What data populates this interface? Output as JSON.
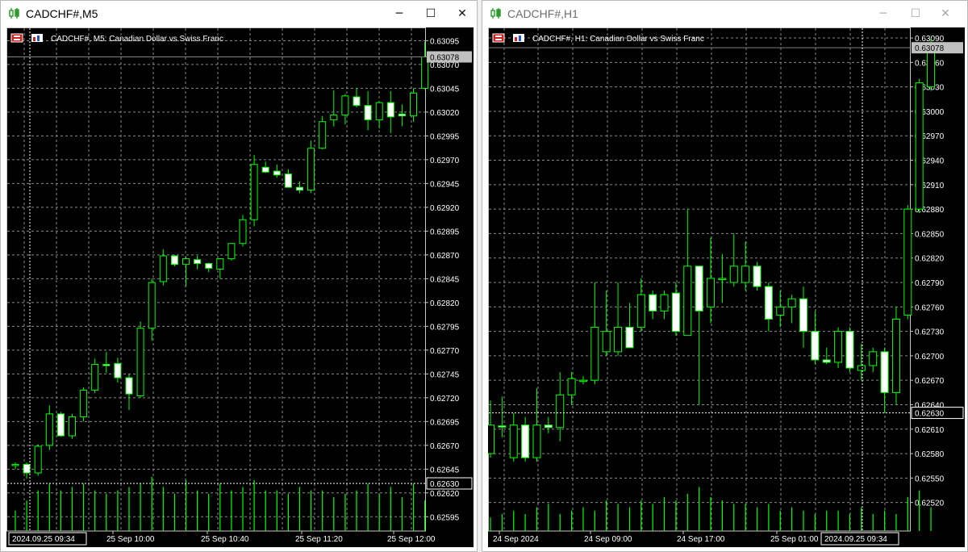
{
  "colors": {
    "background": "#000000",
    "grid": "#8a8a8a",
    "bull": "#00ff00",
    "bear": "#ffffff",
    "text": "#ffffff",
    "current_price_bg": "#c0c0c0"
  },
  "windows": [
    {
      "title": "CADCHF#,M5",
      "state": "active",
      "controls": {
        "minimize": "─",
        "maximize": "☐",
        "close": "✕"
      },
      "chart_data": {
        "type": "candlestick",
        "symbol_label": "CADCHF#, M5:  Canadian Dollar vs Swiss Franc",
        "timeframe": "M5",
        "current_price": "0.63078",
        "marked_price": "0.62630",
        "marked_value": 0.6263,
        "crosshair_time": "2024.09.25 09:34",
        "grid": true,
        "ylim": [
          0.6258,
          0.63103
        ],
        "yticks": [
          "0.63095",
          "0.63070",
          "0.63045",
          "0.63020",
          "0.62995",
          "0.62970",
          "0.62945",
          "0.62920",
          "0.62895",
          "0.62870",
          "0.62845",
          "0.62820",
          "0.62795",
          "0.62770",
          "0.62745",
          "0.62720",
          "0.62695",
          "0.62670",
          "0.62645",
          "0.62620",
          "0.62595"
        ],
        "xticks": [
          "25 Sep 10:00",
          "25 Sep 10:40",
          "25 Sep 11:20",
          "25 Sep 12:00"
        ],
        "candles": [
          {
            "o": 0.62649,
            "h": 0.62652,
            "l": 0.62645,
            "c": 0.6265
          },
          {
            "o": 0.6265,
            "h": 0.62652,
            "l": 0.62635,
            "c": 0.62641
          },
          {
            "o": 0.62641,
            "h": 0.62671,
            "l": 0.62638,
            "c": 0.62669
          },
          {
            "o": 0.6267,
            "h": 0.62712,
            "l": 0.62665,
            "c": 0.62703
          },
          {
            "o": 0.62703,
            "h": 0.62705,
            "l": 0.62679,
            "c": 0.6268
          },
          {
            "o": 0.6268,
            "h": 0.62703,
            "l": 0.62677,
            "c": 0.627
          },
          {
            "o": 0.627,
            "h": 0.62731,
            "l": 0.62695,
            "c": 0.62728
          },
          {
            "o": 0.62728,
            "h": 0.62761,
            "l": 0.62725,
            "c": 0.62755
          },
          {
            "o": 0.62755,
            "h": 0.62768,
            "l": 0.62746,
            "c": 0.62754
          },
          {
            "o": 0.62756,
            "h": 0.62762,
            "l": 0.62736,
            "c": 0.62741
          },
          {
            "o": 0.62741,
            "h": 0.62745,
            "l": 0.62707,
            "c": 0.62724
          },
          {
            "o": 0.62722,
            "h": 0.628,
            "l": 0.6272,
            "c": 0.62793
          },
          {
            "o": 0.62793,
            "h": 0.62845,
            "l": 0.6278,
            "c": 0.62841
          },
          {
            "o": 0.62842,
            "h": 0.62876,
            "l": 0.62838,
            "c": 0.62869
          },
          {
            "o": 0.62869,
            "h": 0.6287,
            "l": 0.62858,
            "c": 0.6286
          },
          {
            "o": 0.6286,
            "h": 0.62868,
            "l": 0.62837,
            "c": 0.62866
          },
          {
            "o": 0.62865,
            "h": 0.62869,
            "l": 0.62855,
            "c": 0.62861
          },
          {
            "o": 0.62861,
            "h": 0.62862,
            "l": 0.62852,
            "c": 0.62856
          },
          {
            "o": 0.62855,
            "h": 0.62866,
            "l": 0.62845,
            "c": 0.62866
          },
          {
            "o": 0.62866,
            "h": 0.62882,
            "l": 0.62864,
            "c": 0.62882
          },
          {
            "o": 0.62882,
            "h": 0.62912,
            "l": 0.62879,
            "c": 0.62907
          },
          {
            "o": 0.62907,
            "h": 0.62975,
            "l": 0.629,
            "c": 0.62965
          },
          {
            "o": 0.62962,
            "h": 0.62968,
            "l": 0.62956,
            "c": 0.62957
          },
          {
            "o": 0.62958,
            "h": 0.62965,
            "l": 0.62951,
            "c": 0.62954
          },
          {
            "o": 0.62955,
            "h": 0.6296,
            "l": 0.62941,
            "c": 0.62941
          },
          {
            "o": 0.62941,
            "h": 0.62947,
            "l": 0.62935,
            "c": 0.62938
          },
          {
            "o": 0.62938,
            "h": 0.6299,
            "l": 0.62935,
            "c": 0.62982
          },
          {
            "o": 0.62982,
            "h": 0.63016,
            "l": 0.62981,
            "c": 0.6301
          },
          {
            "o": 0.63012,
            "h": 0.63043,
            "l": 0.63005,
            "c": 0.63017
          },
          {
            "o": 0.63017,
            "h": 0.63039,
            "l": 0.63007,
            "c": 0.63037
          },
          {
            "o": 0.63036,
            "h": 0.63045,
            "l": 0.63025,
            "c": 0.63027
          },
          {
            "o": 0.63027,
            "h": 0.63042,
            "l": 0.63001,
            "c": 0.63012
          },
          {
            "o": 0.63012,
            "h": 0.63031,
            "l": 0.63003,
            "c": 0.6303
          },
          {
            "o": 0.6303,
            "h": 0.63042,
            "l": 0.62998,
            "c": 0.63015
          },
          {
            "o": 0.63018,
            "h": 0.63028,
            "l": 0.63005,
            "c": 0.63016
          },
          {
            "o": 0.63016,
            "h": 0.63045,
            "l": 0.6301,
            "c": 0.6304
          },
          {
            "o": 0.63045,
            "h": 0.63094,
            "l": 0.63044,
            "c": 0.63078
          }
        ],
        "volumes": [
          6,
          9,
          12,
          14,
          12,
          13,
          14,
          12,
          11,
          12,
          13,
          14,
          16,
          13,
          11,
          15,
          12,
          11,
          14,
          12,
          13,
          15,
          12,
          12,
          11,
          13,
          12,
          12,
          10,
          11,
          12,
          14,
          11,
          13,
          10,
          14,
          9
        ]
      }
    },
    {
      "title": "CADCHF#,H1",
      "state": "inactive",
      "controls": {
        "minimize": "─",
        "maximize": "☐",
        "close": "✕"
      },
      "chart_data": {
        "type": "candlestick",
        "symbol_label": "CADCHF#, H1:  Canadian Dollar vs Swiss Franc",
        "timeframe": "H1",
        "current_price": "0.63078",
        "marked_price": "0.62630",
        "marked_value": 0.6263,
        "crosshair_time": "2024.09.25 09:34",
        "grid": true,
        "ylim": [
          0.62485,
          0.63096
        ],
        "yticks": [
          "0.63090",
          "0.63060",
          "0.63030",
          "0.63000",
          "0.62970",
          "0.62940",
          "0.62910",
          "0.62880",
          "0.62850",
          "0.62820",
          "0.62790",
          "0.62760",
          "0.62730",
          "0.62700",
          "0.62670",
          "0.62640",
          "0.62610",
          "0.62580",
          "0.62550",
          "0.62520"
        ],
        "xticks": [
          "24 Sep 2024",
          "24 Sep 09:00",
          "24 Sep 17:00",
          "25 Sep 01:00"
        ],
        "candles": [
          {
            "o": 0.6258,
            "h": 0.62645,
            "l": 0.62575,
            "c": 0.62615
          },
          {
            "o": 0.62614,
            "h": 0.6265,
            "l": 0.626,
            "c": 0.62613
          },
          {
            "o": 0.62575,
            "h": 0.6263,
            "l": 0.6257,
            "c": 0.62615
          },
          {
            "o": 0.62615,
            "h": 0.62625,
            "l": 0.6257,
            "c": 0.62575
          },
          {
            "o": 0.62575,
            "h": 0.6266,
            "l": 0.6257,
            "c": 0.62615
          },
          {
            "o": 0.62615,
            "h": 0.62625,
            "l": 0.62605,
            "c": 0.62612
          },
          {
            "o": 0.62612,
            "h": 0.6268,
            "l": 0.62595,
            "c": 0.62652
          },
          {
            "o": 0.62652,
            "h": 0.6268,
            "l": 0.6264,
            "c": 0.62672
          },
          {
            "o": 0.6267,
            "h": 0.62675,
            "l": 0.62665,
            "c": 0.6267
          },
          {
            "o": 0.6267,
            "h": 0.6279,
            "l": 0.62665,
            "c": 0.62735
          },
          {
            "o": 0.62705,
            "h": 0.6278,
            "l": 0.627,
            "c": 0.6273
          },
          {
            "o": 0.62705,
            "h": 0.6279,
            "l": 0.627,
            "c": 0.62735
          },
          {
            "o": 0.62735,
            "h": 0.62765,
            "l": 0.62715,
            "c": 0.6271
          },
          {
            "o": 0.62735,
            "h": 0.62795,
            "l": 0.6273,
            "c": 0.62775
          },
          {
            "o": 0.62775,
            "h": 0.6278,
            "l": 0.62745,
            "c": 0.62755
          },
          {
            "o": 0.62755,
            "h": 0.6278,
            "l": 0.62745,
            "c": 0.62775
          },
          {
            "o": 0.62777,
            "h": 0.6279,
            "l": 0.62725,
            "c": 0.6273
          },
          {
            "o": 0.62725,
            "h": 0.6288,
            "l": 0.62725,
            "c": 0.6281
          },
          {
            "o": 0.6281,
            "h": 0.6281,
            "l": 0.6264,
            "c": 0.62755
          },
          {
            "o": 0.6276,
            "h": 0.62845,
            "l": 0.6274,
            "c": 0.62795
          },
          {
            "o": 0.62795,
            "h": 0.62825,
            "l": 0.62765,
            "c": 0.62795
          },
          {
            "o": 0.6279,
            "h": 0.6285,
            "l": 0.62785,
            "c": 0.6281
          },
          {
            "o": 0.6279,
            "h": 0.6284,
            "l": 0.6278,
            "c": 0.6281
          },
          {
            "o": 0.6281,
            "h": 0.62815,
            "l": 0.6278,
            "c": 0.62785
          },
          {
            "o": 0.62785,
            "h": 0.6279,
            "l": 0.6273,
            "c": 0.62745
          },
          {
            "o": 0.6275,
            "h": 0.6278,
            "l": 0.62735,
            "c": 0.6276
          },
          {
            "o": 0.6276,
            "h": 0.62775,
            "l": 0.6274,
            "c": 0.6277
          },
          {
            "o": 0.6277,
            "h": 0.62785,
            "l": 0.6271,
            "c": 0.6273
          },
          {
            "o": 0.6273,
            "h": 0.62755,
            "l": 0.6269,
            "c": 0.62695
          },
          {
            "o": 0.62695,
            "h": 0.6271,
            "l": 0.6269,
            "c": 0.62692
          },
          {
            "o": 0.62692,
            "h": 0.62735,
            "l": 0.62685,
            "c": 0.6273
          },
          {
            "o": 0.6273,
            "h": 0.62735,
            "l": 0.6268,
            "c": 0.62685
          },
          {
            "o": 0.62682,
            "h": 0.62715,
            "l": 0.6267,
            "c": 0.62688
          },
          {
            "o": 0.62688,
            "h": 0.6271,
            "l": 0.6268,
            "c": 0.62705
          },
          {
            "o": 0.62705,
            "h": 0.6271,
            "l": 0.6263,
            "c": 0.62655
          },
          {
            "o": 0.62655,
            "h": 0.6276,
            "l": 0.6264,
            "c": 0.62745
          },
          {
            "o": 0.6275,
            "h": 0.62885,
            "l": 0.62745,
            "c": 0.6288
          },
          {
            "o": 0.6288,
            "h": 0.6304,
            "l": 0.62875,
            "c": 0.63035
          },
          {
            "o": 0.6303,
            "h": 0.6309,
            "l": 0.63025,
            "c": 0.63078
          }
        ],
        "volumes": [
          4,
          5,
          6,
          5,
          7,
          8,
          5,
          6,
          7,
          6,
          9,
          8,
          7,
          9,
          8,
          10,
          9,
          11,
          13,
          10,
          9,
          8,
          8,
          7,
          8,
          6,
          7,
          6,
          5,
          6,
          6,
          5,
          7,
          5,
          6,
          5,
          10,
          12,
          7
        ]
      }
    }
  ]
}
